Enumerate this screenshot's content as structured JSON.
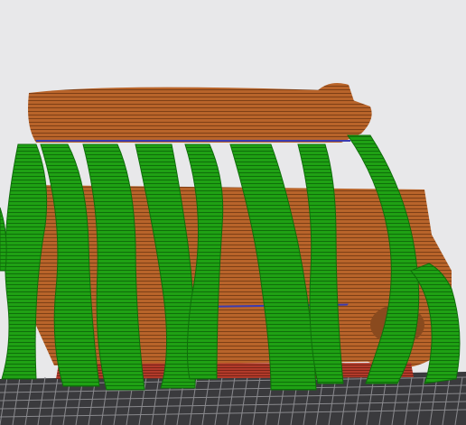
{
  "viewport": {
    "background_color": "#e8e8ea",
    "build_plate_color": "#3a3a3d",
    "grid_line_color": "#8a8a8e"
  },
  "model": {
    "layer_color": "#b8642a",
    "layer_dark_color": "#7e3f16",
    "bottom_layer_color": "#b23a2a",
    "seam_color": "#3b3bb0"
  },
  "supports": {
    "color": "#1fa114",
    "shade_color": "#0f6e0a",
    "type": "tree"
  }
}
